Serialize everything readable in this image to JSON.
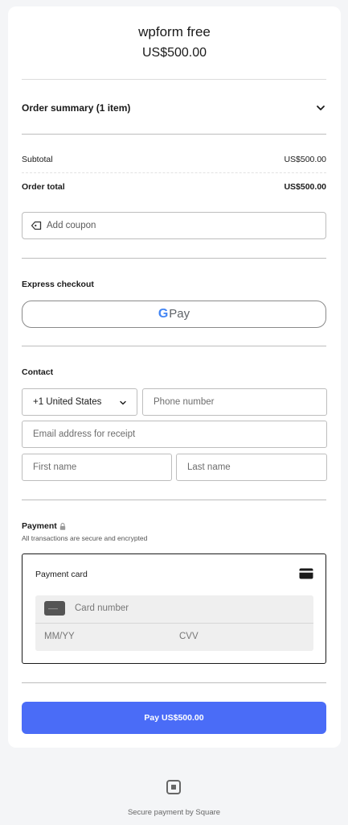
{
  "header": {
    "title": "wpform free",
    "price": "US$500.00"
  },
  "summary": {
    "label": "Order summary (1 item)",
    "subtotal_label": "Subtotal",
    "subtotal_value": "US$500.00",
    "total_label": "Order total",
    "total_value": "US$500.00"
  },
  "coupon": {
    "label": "Add coupon"
  },
  "express": {
    "label": "Express checkout",
    "gpay_g": "G",
    "gpay_pay": "Pay"
  },
  "contact": {
    "label": "Contact",
    "country_code": "+1 United States",
    "phone_placeholder": "Phone number",
    "email_placeholder": "Email address for receipt",
    "first_name_placeholder": "First name",
    "last_name_placeholder": "Last name"
  },
  "payment": {
    "label": "Payment",
    "subtitle": "All transactions are secure and encrypted",
    "card_title": "Payment card",
    "card_number_placeholder": "Card number",
    "expiry_placeholder": "MM/YY",
    "cvv_placeholder": "CVV"
  },
  "pay_button": {
    "label": "Pay  US$500.00"
  },
  "footer": {
    "text": "Secure payment by Square"
  },
  "colors": {
    "accent": "#4a6cf7",
    "background": "#f4f5f7"
  },
  "icons": [
    "chevron-down-icon",
    "tag-icon",
    "lock-icon",
    "credit-card-icon",
    "card-chip-icon",
    "square-logo-icon"
  ]
}
